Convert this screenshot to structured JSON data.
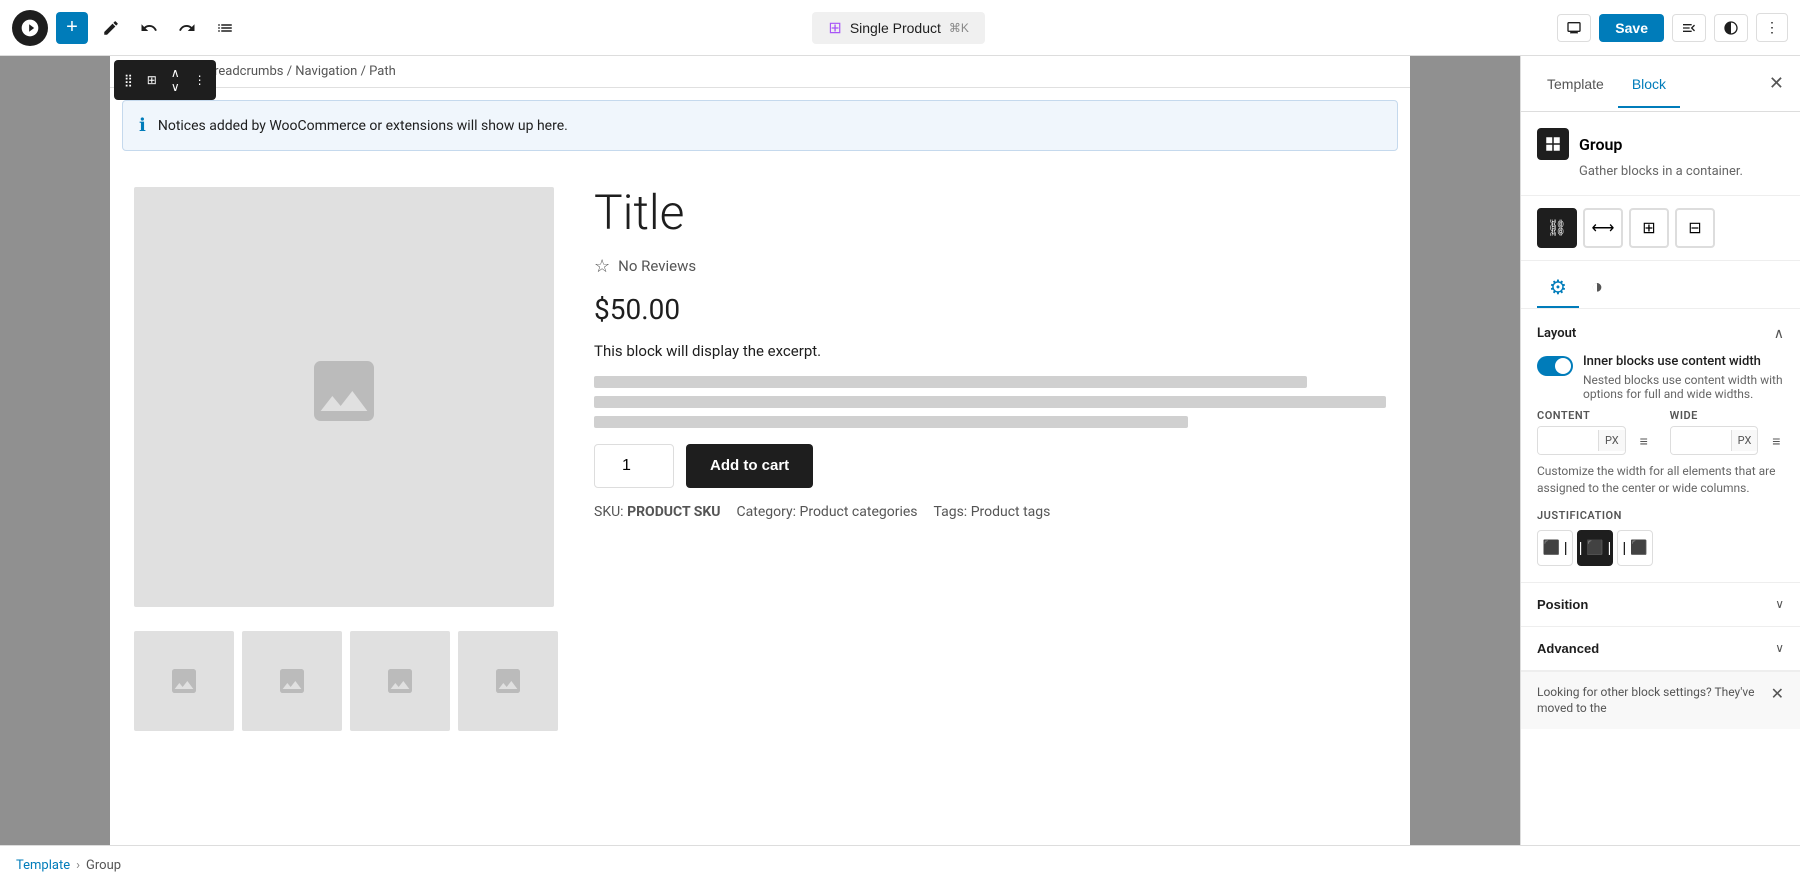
{
  "toolbar": {
    "add_label": "+",
    "undo_label": "↩",
    "redo_label": "↪",
    "list_view_label": "≡",
    "save_label": "Save",
    "page_title": "Single Product",
    "keyboard_shortcut": "⌘K"
  },
  "breadcrumb": {
    "path": "Breadcrumbs / Navigation / Path"
  },
  "notice": {
    "text": "Notices added by WooCommerce or extensions will show up here."
  },
  "product": {
    "title": "Title",
    "reviews": "No Reviews",
    "price": "$50.00",
    "excerpt": "This block will display the excerpt.",
    "quantity": "1",
    "add_to_cart": "Add to cart",
    "sku_label": "SKU:",
    "sku_value": "PRODUCT SKU",
    "category_label": "Category:",
    "category_value": "Product categories",
    "tags_label": "Tags:",
    "tags_value": "Product tags"
  },
  "right_panel": {
    "tab_template": "Template",
    "tab_block": "Block",
    "block_name": "Group",
    "block_description": "Gather blocks in a container.",
    "layout_title": "Layout",
    "toggle_label": "Inner blocks use content width",
    "toggle_sublabel": "Nested blocks use content width with options for full and wide widths.",
    "content_label": "CONTENT",
    "wide_label": "WIDE",
    "px_label": "PX",
    "customize_text": "Customize the width for all elements that are assigned to the center or wide columns.",
    "justification_label": "JUSTIFICATION",
    "position_label": "Position",
    "advanced_label": "Advanced",
    "block_notice_text": "Looking for other block settings? They've moved to the"
  },
  "footer": {
    "template_label": "Template",
    "separator": "›",
    "group_label": "Group"
  }
}
